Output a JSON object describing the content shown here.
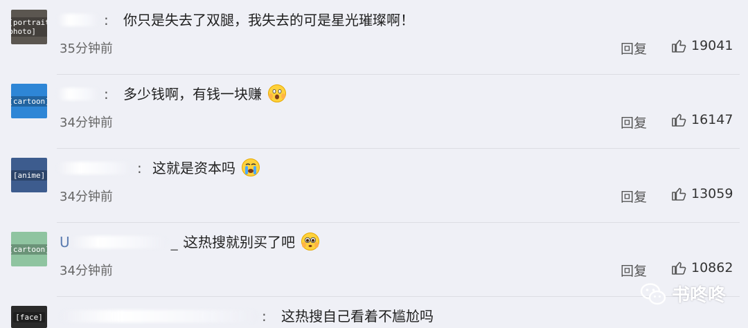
{
  "comments": [
    {
      "avatar": "[portrait photo]",
      "avatar_bg": "#5b5650",
      "username": "",
      "text": "你只是失去了双腿，我失去的可是星光璀璨啊！",
      "emoji": null,
      "time": "35分钟前",
      "reply": "回复",
      "likes": "19041"
    },
    {
      "avatar": "[cartoon]",
      "avatar_bg": "#2e86d6",
      "username": "",
      "text": "多少钱啊，有钱一块赚",
      "emoji": "scared-face-emoji",
      "time": "34分钟前",
      "reply": "回复",
      "likes": "16147"
    },
    {
      "avatar": "[anime]",
      "avatar_bg": "#3d5c8e",
      "username": "",
      "text": "这就是资本吗",
      "emoji": "crying-face-emoji",
      "time": "34分钟前",
      "reply": "回复",
      "likes": "13059"
    },
    {
      "avatar": "[cartoon]",
      "avatar_bg": "#8fc4a0",
      "username": "U",
      "text": "这热搜就别买了吧",
      "emoji": "pleading-face-emoji",
      "time": "34分钟前",
      "reply": "回复",
      "likes": "10862"
    },
    {
      "avatar": "[face]",
      "avatar_bg": "#2a2a2a",
      "username": "",
      "text": "这热搜自己看着不尴尬吗",
      "emoji": null,
      "time": "",
      "reply": "",
      "likes": ""
    }
  ],
  "watermark": "书咚咚",
  "colors": {
    "background": "#eff0f6",
    "username": "#5a7bb0",
    "divider": "#dcdde3"
  }
}
